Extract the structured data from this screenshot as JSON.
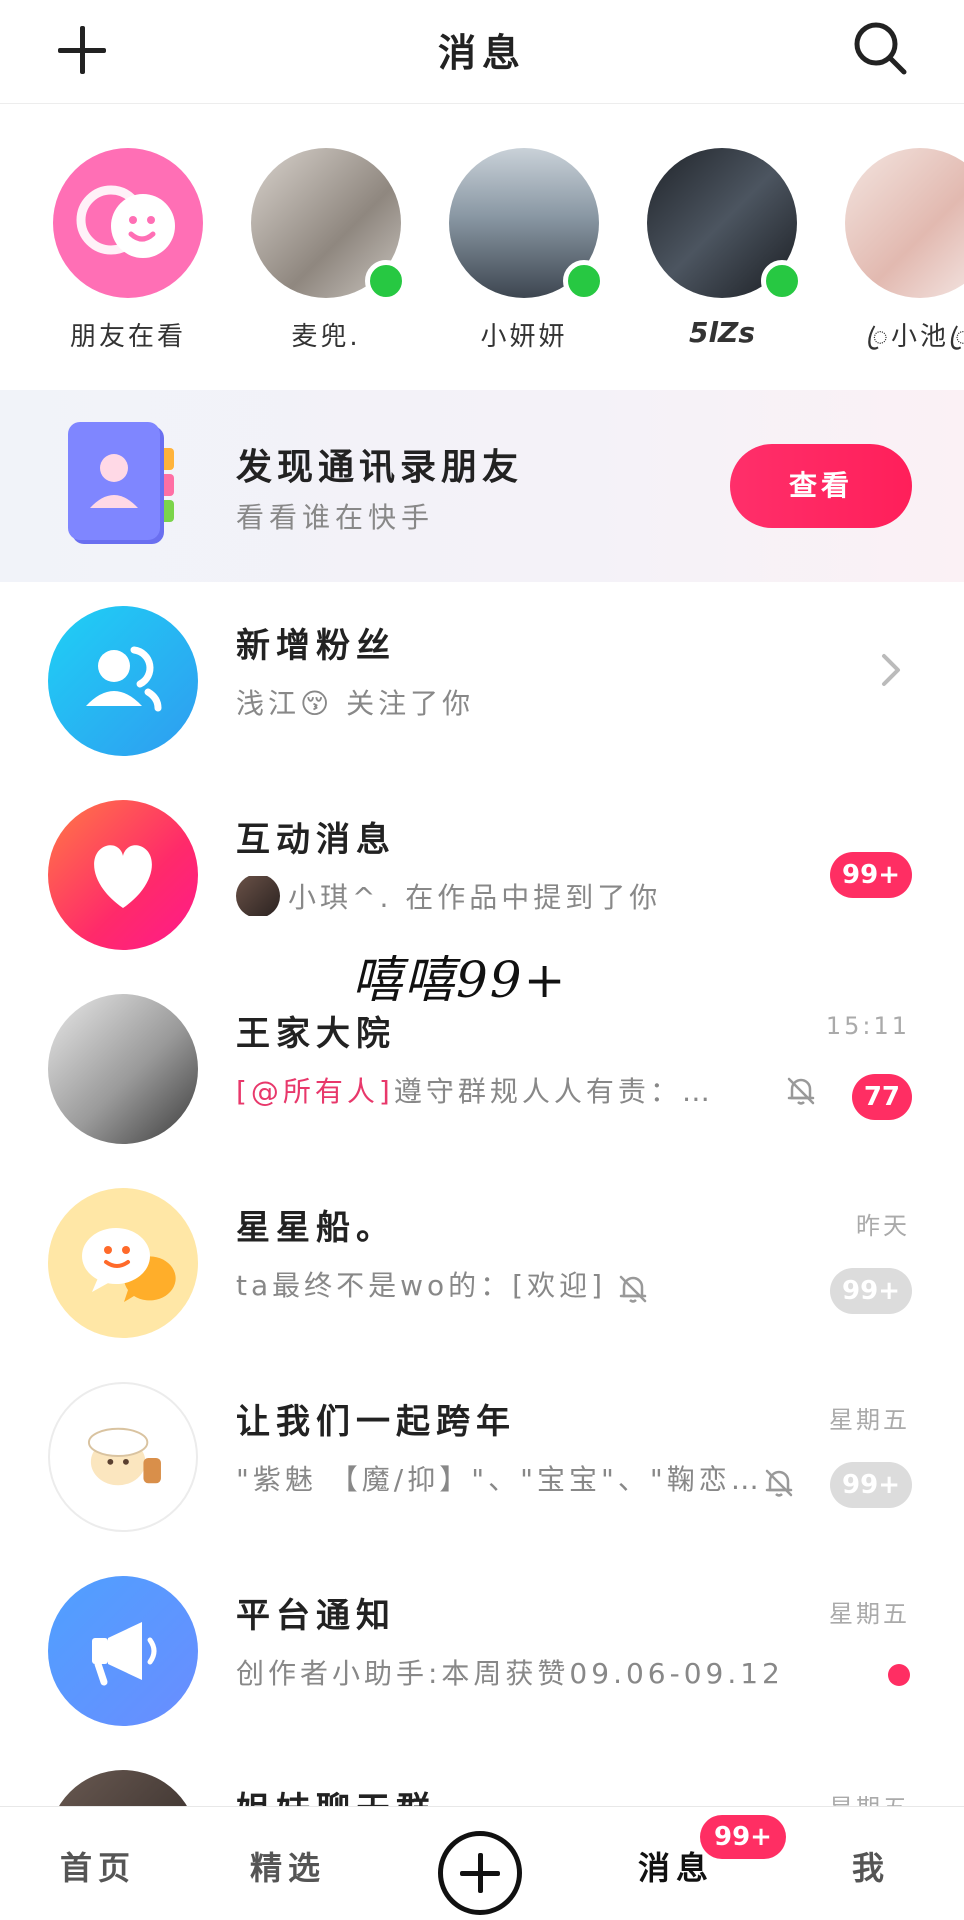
{
  "header": {
    "title": "消息"
  },
  "stories": [
    {
      "name": "朋友在看",
      "online": false
    },
    {
      "name": "麦兜.",
      "online": true
    },
    {
      "name": "小妍妍",
      "online": true
    },
    {
      "name": "5lZs",
      "online": true
    },
    {
      "name": "ꦿ小池ꦿ",
      "online": false
    }
  ],
  "banner": {
    "title": "发现通讯录朋友",
    "subtitle": "看看谁在快手",
    "button": "查看"
  },
  "rows": [
    {
      "name": "新增粉丝",
      "preview": "浅江😚 关注了你",
      "time": "",
      "badge": ""
    },
    {
      "name": "互动消息",
      "preview": "小琪^. 在作品中提到了你",
      "time": "",
      "badge": "99+"
    },
    {
      "name": "王家大院",
      "preview_mention": "[@所有人]",
      "preview": "遵守群规人人有责：…",
      "time": "15:11",
      "badge": "77"
    },
    {
      "name": "星星船。",
      "preview": "ta最终不是wo的：[欢迎]",
      "time": "昨天",
      "badge": "99+"
    },
    {
      "name": "让我们一起跨年",
      "preview": "\"紫魅 【魔/抑】\"、\"宝宝\"、\"鞠恋…",
      "time": "星期五",
      "badge": "99+"
    },
    {
      "name": "平台通知",
      "preview": "创作者小助手:本周获赞09.06-09.12",
      "time": "星期五",
      "badge": ""
    },
    {
      "name": "姐妹聊天群",
      "preview": "",
      "time": "星期五",
      "badge": ""
    }
  ],
  "overlay_text": "嘻嘻99+",
  "bottom_nav": {
    "home": "首页",
    "featured": "精选",
    "messages": "消息",
    "messages_badge": "99+",
    "me": "我"
  },
  "colors": {
    "accent": "#ff2e63",
    "online": "#27c842",
    "followers_icon": "#22b8f0",
    "interaction_icon": "#ff3a7a",
    "platform_icon": "#5a9cff"
  }
}
